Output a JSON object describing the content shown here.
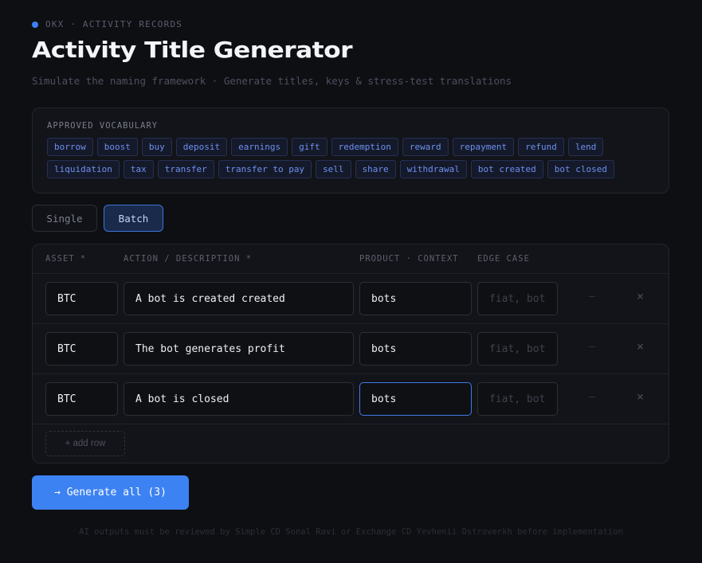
{
  "brand": {
    "label": "OKX · ACTIVITY RECORDS",
    "accent_color": "#3b82f6"
  },
  "header": {
    "title": "Activity Title Generator",
    "subtitle": "Simulate the naming framework · Generate titles, keys & stress-test translations"
  },
  "vocabulary": {
    "title": "APPROVED VOCABULARY",
    "chips": [
      "borrow",
      "boost",
      "buy",
      "deposit",
      "earnings",
      "gift",
      "redemption",
      "reward",
      "repayment",
      "refund",
      "lend",
      "liquidation",
      "tax",
      "transfer",
      "transfer to pay",
      "sell",
      "share",
      "withdrawal",
      "bot created",
      "bot closed"
    ]
  },
  "mode_tabs": {
    "single": "Single",
    "batch": "Batch",
    "active": "Batch"
  },
  "batch": {
    "columns": {
      "asset": "ASSET *",
      "action": "ACTION / DESCRIPTION *",
      "product": "PRODUCT · CONTEXT",
      "edge": "EDGE CASE"
    },
    "edge_placeholder": "fiat, bot",
    "dash": "–",
    "remove_glyph": "×",
    "rows": [
      {
        "asset": "BTC",
        "action": "A bot is created created",
        "product": "bots",
        "edge": ""
      },
      {
        "asset": "BTC",
        "action": "The bot generates profit",
        "product": "bots",
        "edge": ""
      },
      {
        "asset": "BTC",
        "action": "A bot is closed",
        "product": "bots",
        "edge": ""
      }
    ],
    "add_row_label": "+ add row"
  },
  "generate_button": "→ Generate all (3)",
  "footer": "AI outputs must be reviewed by Simple CD Sonal Ravi or Exchange CD Yevhenii Ostroverkh before implementation"
}
